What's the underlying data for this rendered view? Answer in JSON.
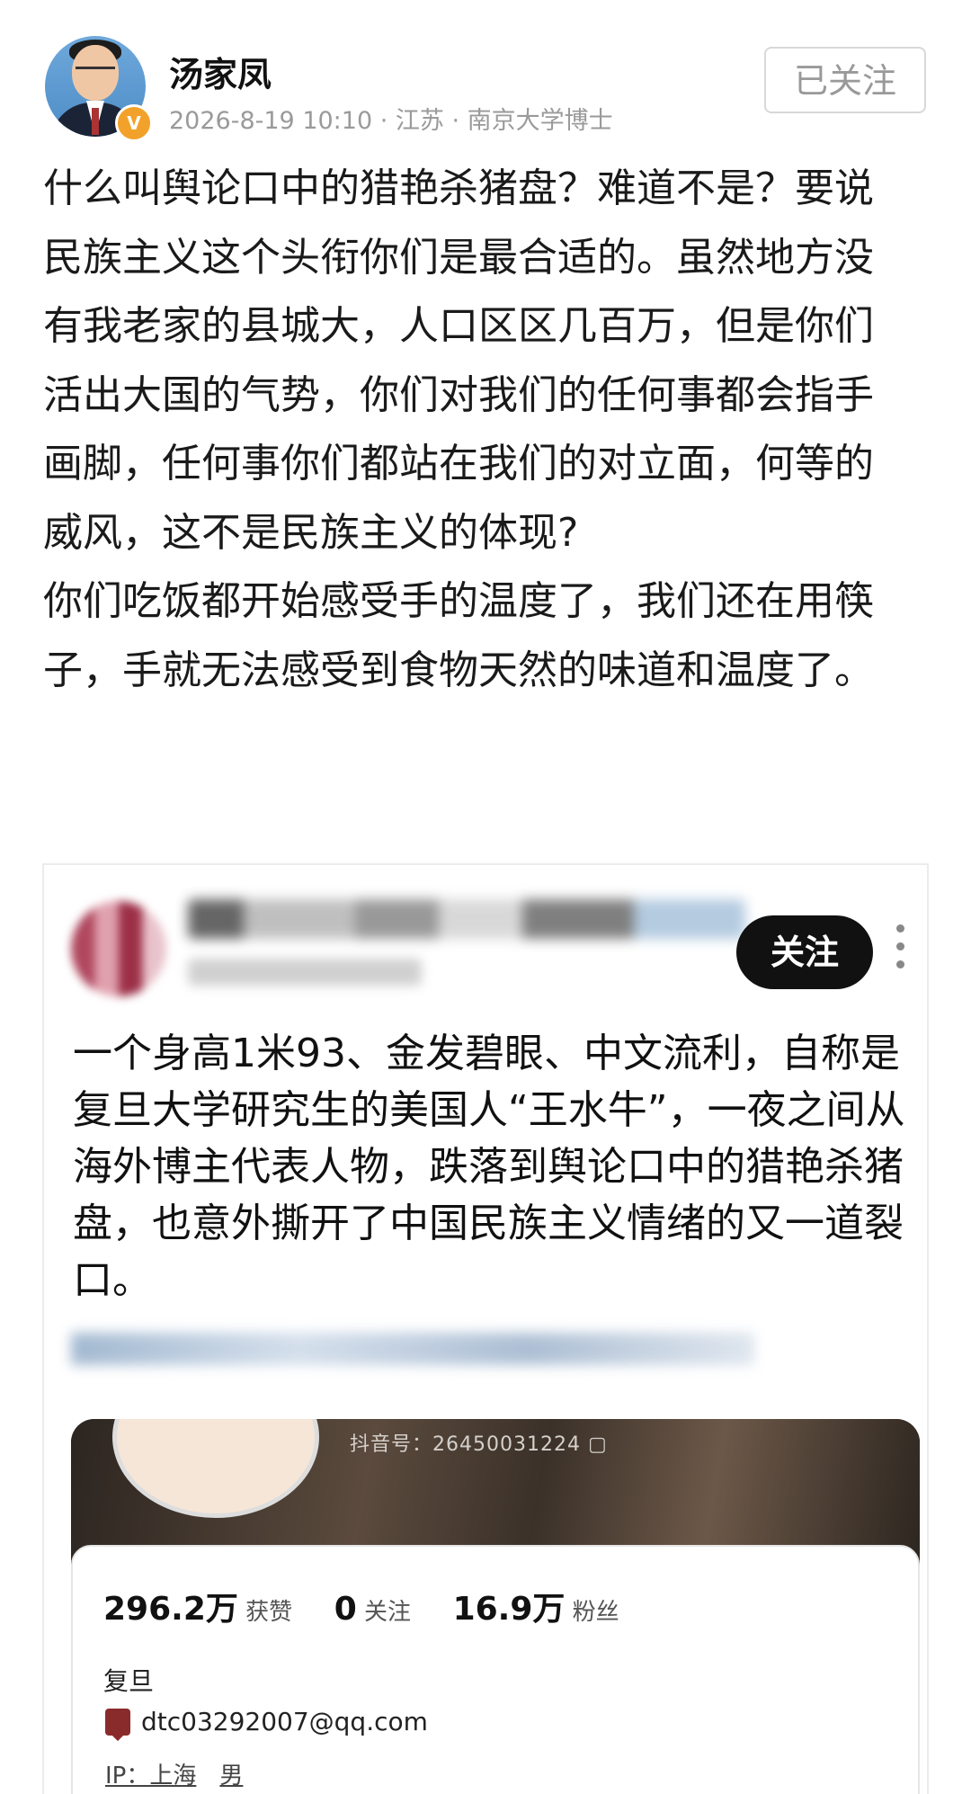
{
  "post": {
    "author": "汤家凤",
    "meta": "2026-8-19 10:10 · 江苏 · 南京大学博士",
    "follow_label": "已关注",
    "badge": "V",
    "paragraphs": [
      "什么叫舆论口中的猎艳杀猪盘？难道不是？要说民族主义这个头衔你们是最合适的。虽然地方没有我老家的县城大，人口区区几百万，但是你们活出大国的气势，你们对我们的任何事都会指手画脚，任何事你们都站在我们的对立面，何等的威风，这不是民族主义的体现?",
      "你们吃饭都开始感受手的温度了，我们还在用筷子，手就无法感受到食物天然的味道和温度了。"
    ]
  },
  "quoted": {
    "follow_label": "关注",
    "text": "一个身高1米93、金发碧眼、中文流利，自称是复旦大学研究生的美国人“王水牛”，一夜之间从海外博主代表人物，跌落到舆论口中的猎艳杀猪盘，也意外撕开了中国民族主义情绪的又一道裂口。",
    "profile": {
      "douyin_id": "抖音号：26450031224 ▢",
      "likes_value": "296.2万",
      "likes_label": "获赞",
      "following_value": "0",
      "following_label": "关注",
      "fans_value": "16.9万",
      "fans_label": "粉丝",
      "school": "复旦",
      "email": "dtc03292007@qq.com",
      "ip": "IP：上海",
      "gender": "男"
    }
  }
}
